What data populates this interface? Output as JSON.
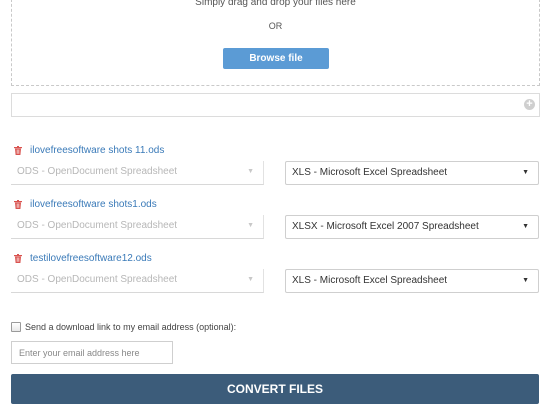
{
  "dropzone": {
    "instruction": "Simply drag and drop your files here",
    "or_label": "OR",
    "browse_label": "Browse file"
  },
  "url_bar": {
    "add_icon": "plus-circle-icon"
  },
  "files": [
    {
      "name": "ilovefreesoftware shots 11.ods",
      "from_format": "ODS - OpenDocument Spreadsheet",
      "to_format": "XLS - Microsoft Excel Spreadsheet"
    },
    {
      "name": "ilovefreesoftware shots1.ods",
      "from_format": "ODS - OpenDocument Spreadsheet",
      "to_format": "XLSX - Microsoft Excel 2007 Spreadsheet"
    },
    {
      "name": "testilovefreesoftware12.ods",
      "from_format": "ODS - OpenDocument Spreadsheet",
      "to_format": "XLS - Microsoft Excel Spreadsheet"
    }
  ],
  "email": {
    "checkbox_label": "Send a download link to my email address (optional):",
    "checked": false,
    "placeholder": "Enter your email address here",
    "value": ""
  },
  "convert_label": "CONVERT FILES",
  "colors": {
    "browse_button": "#5b9bd5",
    "convert_button": "#3c5c7a",
    "file_link": "#3a7ab8",
    "trash_icon": "#d9534f"
  }
}
